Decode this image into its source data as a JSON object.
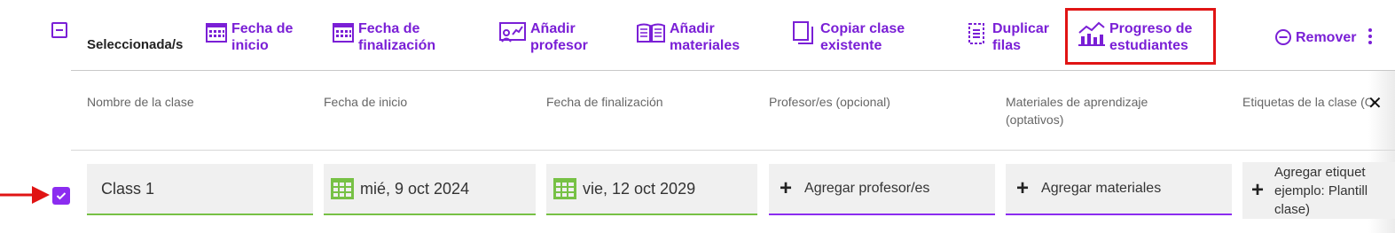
{
  "toolbar": {
    "selected_label": "Seleccionada/s",
    "buttons": [
      {
        "icon": "calendar-icon",
        "label": "Fecha de\ninicio"
      },
      {
        "icon": "calendar-icon",
        "label": "Fecha de\nfinalización"
      },
      {
        "icon": "add-teacher-icon",
        "label": "Añadir\nprofesor"
      },
      {
        "icon": "book-icon",
        "label": "Añadir\nmateriales"
      },
      {
        "icon": "copy-icon",
        "label": "Copiar clase\nexistente"
      },
      {
        "icon": "duplicate-icon",
        "label": "Duplicar\nfilas"
      },
      {
        "icon": "progress-chart-icon",
        "label": "Progreso de\nestudiantes"
      }
    ],
    "remove_label": "Remover",
    "more_icon": "kebab-icon"
  },
  "table": {
    "headers": [
      "Nombre de la clase",
      "Fecha de inicio",
      "Fecha de finalización",
      "Profesor/es (opcional)",
      "Materiales de aprendizaje\n(optativos)",
      "Etiquetas de la clase (O"
    ],
    "close_icon": "close-icon",
    "rows": [
      {
        "checked": true,
        "class_name": "Class 1",
        "start_date": "mié, 9 oct 2024",
        "end_date": "vie, 12 oct 2029",
        "teacher_action": "Agregar profesor/es",
        "materials_action": "Agregar materiales",
        "tags_placeholder": "Agregar etiquet\nejemplo: Plantill\nclase)"
      }
    ]
  },
  "colors": {
    "accent": "#7a1fd6",
    "highlight": "#e01414",
    "date_green": "#77c145",
    "checkbox": "#8b2cf0"
  }
}
